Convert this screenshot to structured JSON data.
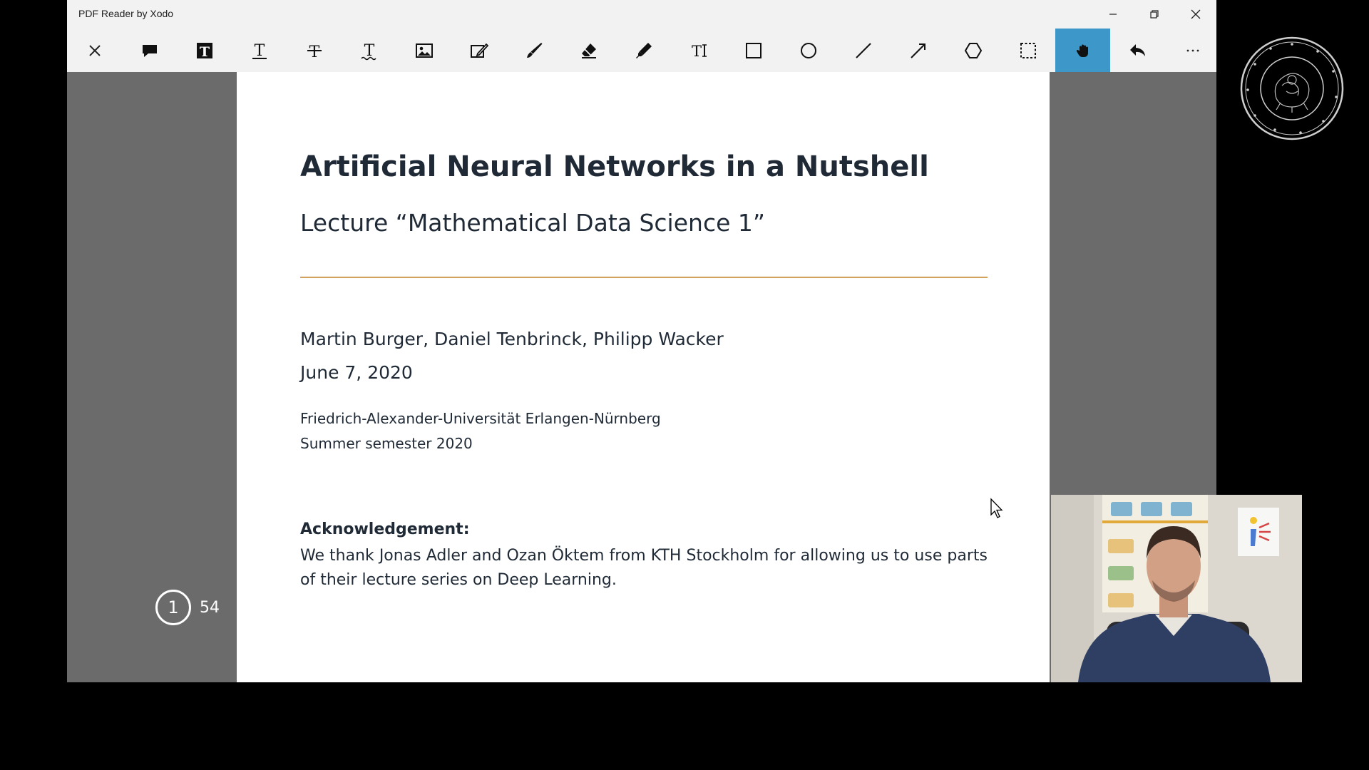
{
  "window": {
    "title": "PDF Reader by Xodo",
    "controls": [
      "minimize",
      "restore",
      "close"
    ]
  },
  "toolbar": {
    "tools": [
      {
        "name": "close-document",
        "icon": "close-icon"
      },
      {
        "name": "sticky-note",
        "icon": "comment-icon"
      },
      {
        "name": "highlight-text",
        "icon": "text-highlight-icon"
      },
      {
        "name": "underline-text",
        "icon": "text-underline-icon"
      },
      {
        "name": "strikeout-text",
        "icon": "text-strikeout-icon"
      },
      {
        "name": "squiggly-text",
        "icon": "text-squiggly-icon"
      },
      {
        "name": "image-stamp",
        "icon": "image-icon"
      },
      {
        "name": "signature",
        "icon": "signature-icon"
      },
      {
        "name": "free-hand-pen",
        "icon": "pen-icon"
      },
      {
        "name": "eraser",
        "icon": "eraser-icon"
      },
      {
        "name": "highlighter",
        "icon": "highlighter-icon"
      },
      {
        "name": "free-text",
        "icon": "free-text-icon"
      },
      {
        "name": "rectangle",
        "icon": "rectangle-icon"
      },
      {
        "name": "ellipse",
        "icon": "ellipse-icon"
      },
      {
        "name": "line",
        "icon": "line-icon"
      },
      {
        "name": "arrow",
        "icon": "arrow-icon"
      },
      {
        "name": "polygon",
        "icon": "polygon-icon"
      },
      {
        "name": "area-select",
        "icon": "selection-icon"
      },
      {
        "name": "pan",
        "icon": "hand-icon"
      },
      {
        "name": "undo",
        "icon": "undo-icon"
      },
      {
        "name": "more",
        "icon": "more-icon"
      }
    ],
    "active_tool": "pan",
    "accent_color": "#3d97c9"
  },
  "document": {
    "title": "Artificial Neural Networks in a Nutshell",
    "subtitle": "Lecture “Mathematical Data Science 1”",
    "authors": "Martin Burger, Daniel Tenbrinck, Philipp Wacker",
    "date": "June 7, 2020",
    "university": "Friedrich-Alexander-Universität Erlangen-Nürnberg",
    "semester": "Summer semester 2020",
    "ack_heading": "Acknowledgement:",
    "ack_text": "We thank Jonas Adler and Ozan Öktem from KTH Stockholm for allowing us to use parts of their lecture series on Deep Learning.",
    "rule_color": "#d2a15c"
  },
  "page_indicator": {
    "current": "1",
    "total": "54"
  },
  "overlay": {
    "seal": "university-seal",
    "webcam": "presenter-webcam"
  }
}
